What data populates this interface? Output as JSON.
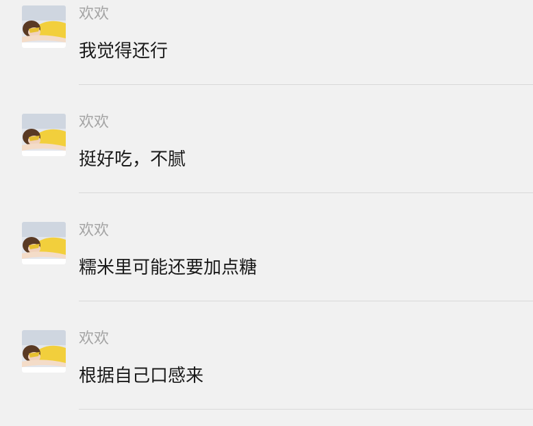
{
  "comments": [
    {
      "name": "欢欢",
      "text": "我觉得还行"
    },
    {
      "name": "欢欢",
      "text": "挺好吃，不腻"
    },
    {
      "name": "欢欢",
      "text": "糯米里可能还要加点糖"
    },
    {
      "name": "欢欢",
      "text": "根据自己口感来"
    }
  ]
}
